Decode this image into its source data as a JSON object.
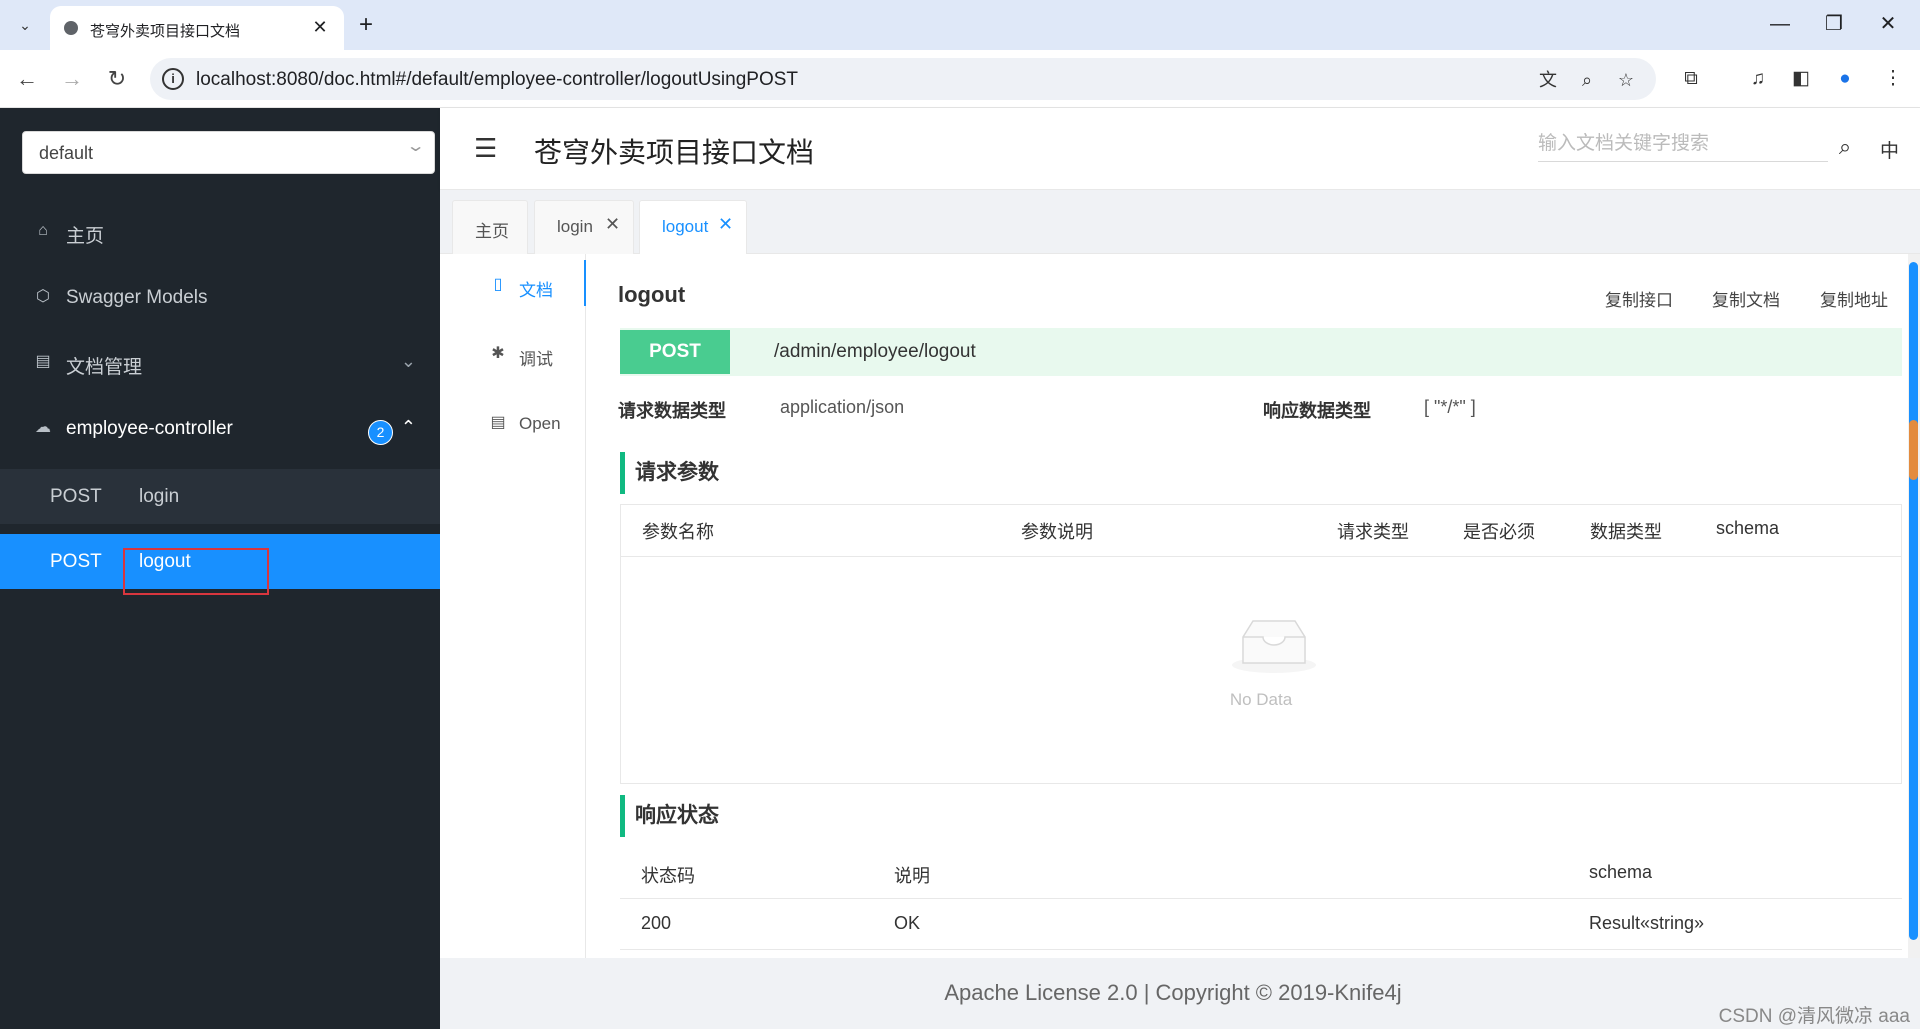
{
  "browser": {
    "tab_title": "苍穹外卖项目接口文档",
    "tab_close": "✕",
    "new_tab": "+",
    "url": "localhost:8080/doc.html#/default/employee-controller/logoutUsingPOST",
    "win_min": "—",
    "win_max": "❐",
    "win_close": "✕",
    "tabs_menu": "⌄"
  },
  "sidebar": {
    "group_select": "default",
    "items": [
      {
        "label": "主页",
        "icon": "home-icon"
      },
      {
        "label": "Swagger Models",
        "icon": "model-icon"
      },
      {
        "label": "文档管理",
        "icon": "document-icon"
      },
      {
        "label": "employee-controller",
        "icon": "cloud-icon",
        "badge": "2"
      }
    ],
    "sub_items": [
      {
        "method": "POST",
        "label": "login"
      },
      {
        "method": "POST",
        "label": "logout"
      }
    ]
  },
  "header": {
    "title": "苍穹外卖项目接口文档",
    "search_placeholder": "输入文档关键字搜索",
    "lang": "中"
  },
  "tabs": [
    {
      "label": "主页"
    },
    {
      "label": "login"
    },
    {
      "label": "logout"
    }
  ],
  "submenu": [
    {
      "label": "文档"
    },
    {
      "label": "调试"
    },
    {
      "label": "Open"
    }
  ],
  "api": {
    "name": "logout",
    "copy_actions": [
      "复制接口",
      "复制文档",
      "复制地址"
    ],
    "method": "POST",
    "path": "/admin/employee/logout",
    "request_type_label": "请求数据类型",
    "request_type": "application/json",
    "response_type_label": "响应数据类型",
    "response_type": "[ \"*/*\" ]"
  },
  "params": {
    "title": "请求参数",
    "columns": [
      "参数名称",
      "参数说明",
      "请求类型",
      "是否必须",
      "数据类型",
      "schema"
    ],
    "empty": "No Data"
  },
  "responses": {
    "title": "响应状态",
    "columns": [
      "状态码",
      "说明",
      "schema"
    ],
    "rows": [
      {
        "code": "200",
        "desc": "OK",
        "schema": "Result«string»"
      }
    ]
  },
  "footer": {
    "text": "Apache License 2.0 | Copyright © 2019-Knife4j",
    "watermark": "CSDN @清风微凉 aaa"
  },
  "colors": {
    "accent": "#1890ff",
    "post": "#49cc90",
    "section_bar": "#10b981",
    "highlight_box": "#d9363e"
  }
}
